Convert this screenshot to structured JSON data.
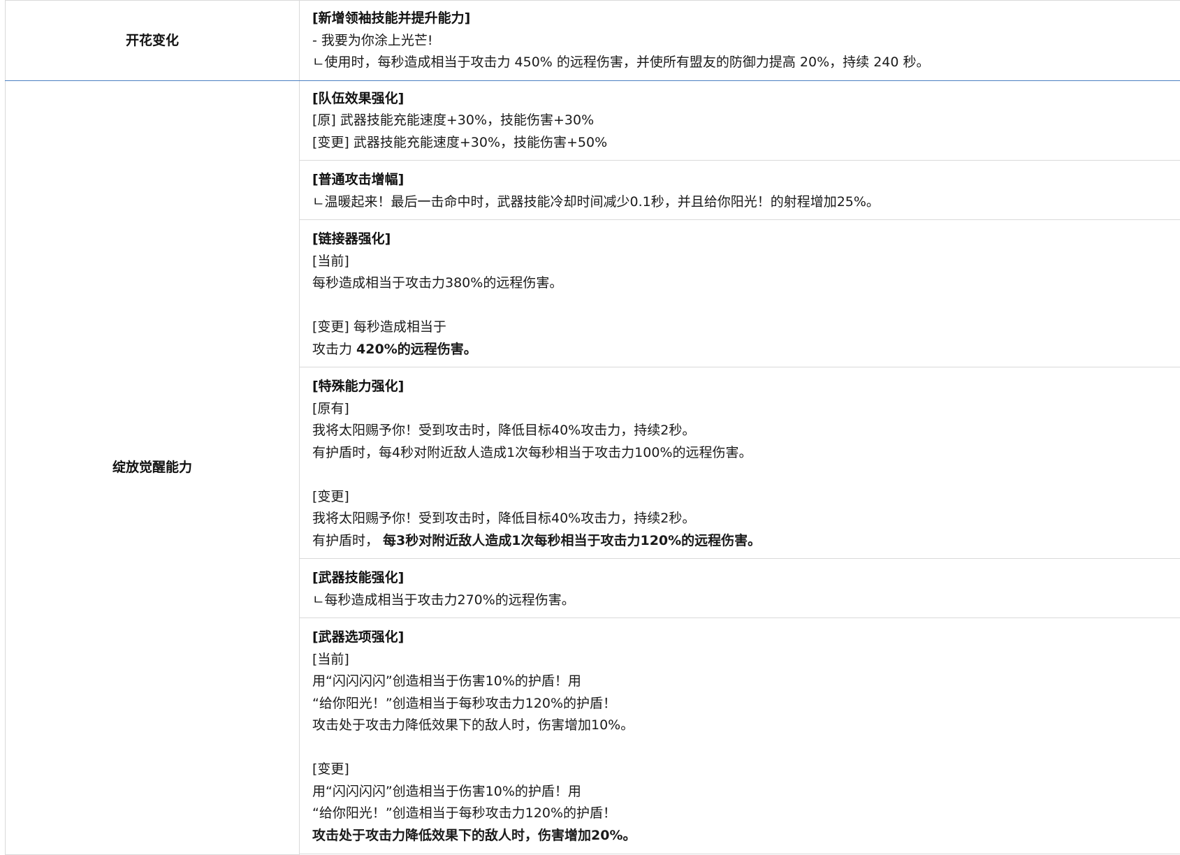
{
  "rows": {
    "bloom": {
      "label": "开花变化",
      "block": {
        "title": "[新增领袖技能并提升能力]",
        "line1": "- 我要为你涂上光芒!",
        "line2": "ㄴ使用时，每秒造成相当于攻击力 450% 的远程伤害，并使所有盟友的防御力提高 20%，持续 240 秒。"
      }
    },
    "awaken": {
      "label": "绽放觉醒能力",
      "team": {
        "title": "[队伍效果强化]",
        "line1": "[原] 武器技能充能速度+30%，技能伤害+30%",
        "line2": "[变更] 武器技能充能速度+30%，技能伤害+50%"
      },
      "normal": {
        "title": "[普通攻击增幅]",
        "line1": "ㄴ温暖起来！最后一击命中时，武器技能冷却时间减少0.1秒，并且给你阳光！的射程增加25%。"
      },
      "linker": {
        "title": "[链接器强化]",
        "line1": "[当前]",
        "line2": "每秒造成相当于攻击力380%的远程伤害。",
        "line3": "[变更] 每秒造成相当于",
        "line4_prefix": "攻击力 ",
        "line4_bold": "420%的远程伤害。"
      },
      "special": {
        "title": "[特殊能力强化]",
        "line1": "[原有]",
        "line2": "我将太阳赐予你！受到攻击时，降低目标40%攻击力，持续2秒。",
        "line3": "有护盾时，每4秒对附近敌人造成1次每秒相当于攻击力100%的远程伤害。",
        "line4": "[变更]",
        "line5": "我将太阳赐予你！受到攻击时，降低目标40%攻击力，持续2秒。",
        "line6_prefix": "有护盾时， ",
        "line6_bold": "每3秒对附近敌人造成1次每秒相当于攻击力120%的远程伤害。"
      },
      "weapon_skill": {
        "title": "[武器技能强化]",
        "line1": "ㄴ每秒造成相当于攻击力270%的远程伤害。"
      },
      "weapon_option": {
        "title": "[武器选项强化]",
        "line1": "[当前]",
        "line2": "用“闪闪闪闪”创造相当于伤害10%的护盾！用",
        "line3": "“给你阳光！”创造相当于每秒攻击力120%的护盾！",
        "line4": "攻击处于攻击力降低效果下的敌人时，伤害增加10%。",
        "line5": "[变更]",
        "line6": "用“闪闪闪闪”创造相当于伤害10%的护盾！用",
        "line7": "“给你阳光！”创造相当于每秒攻击力120%的护盾！",
        "line8_bold": "攻击处于攻击力降低效果下的敌人时，伤害增加20%。"
      }
    }
  }
}
